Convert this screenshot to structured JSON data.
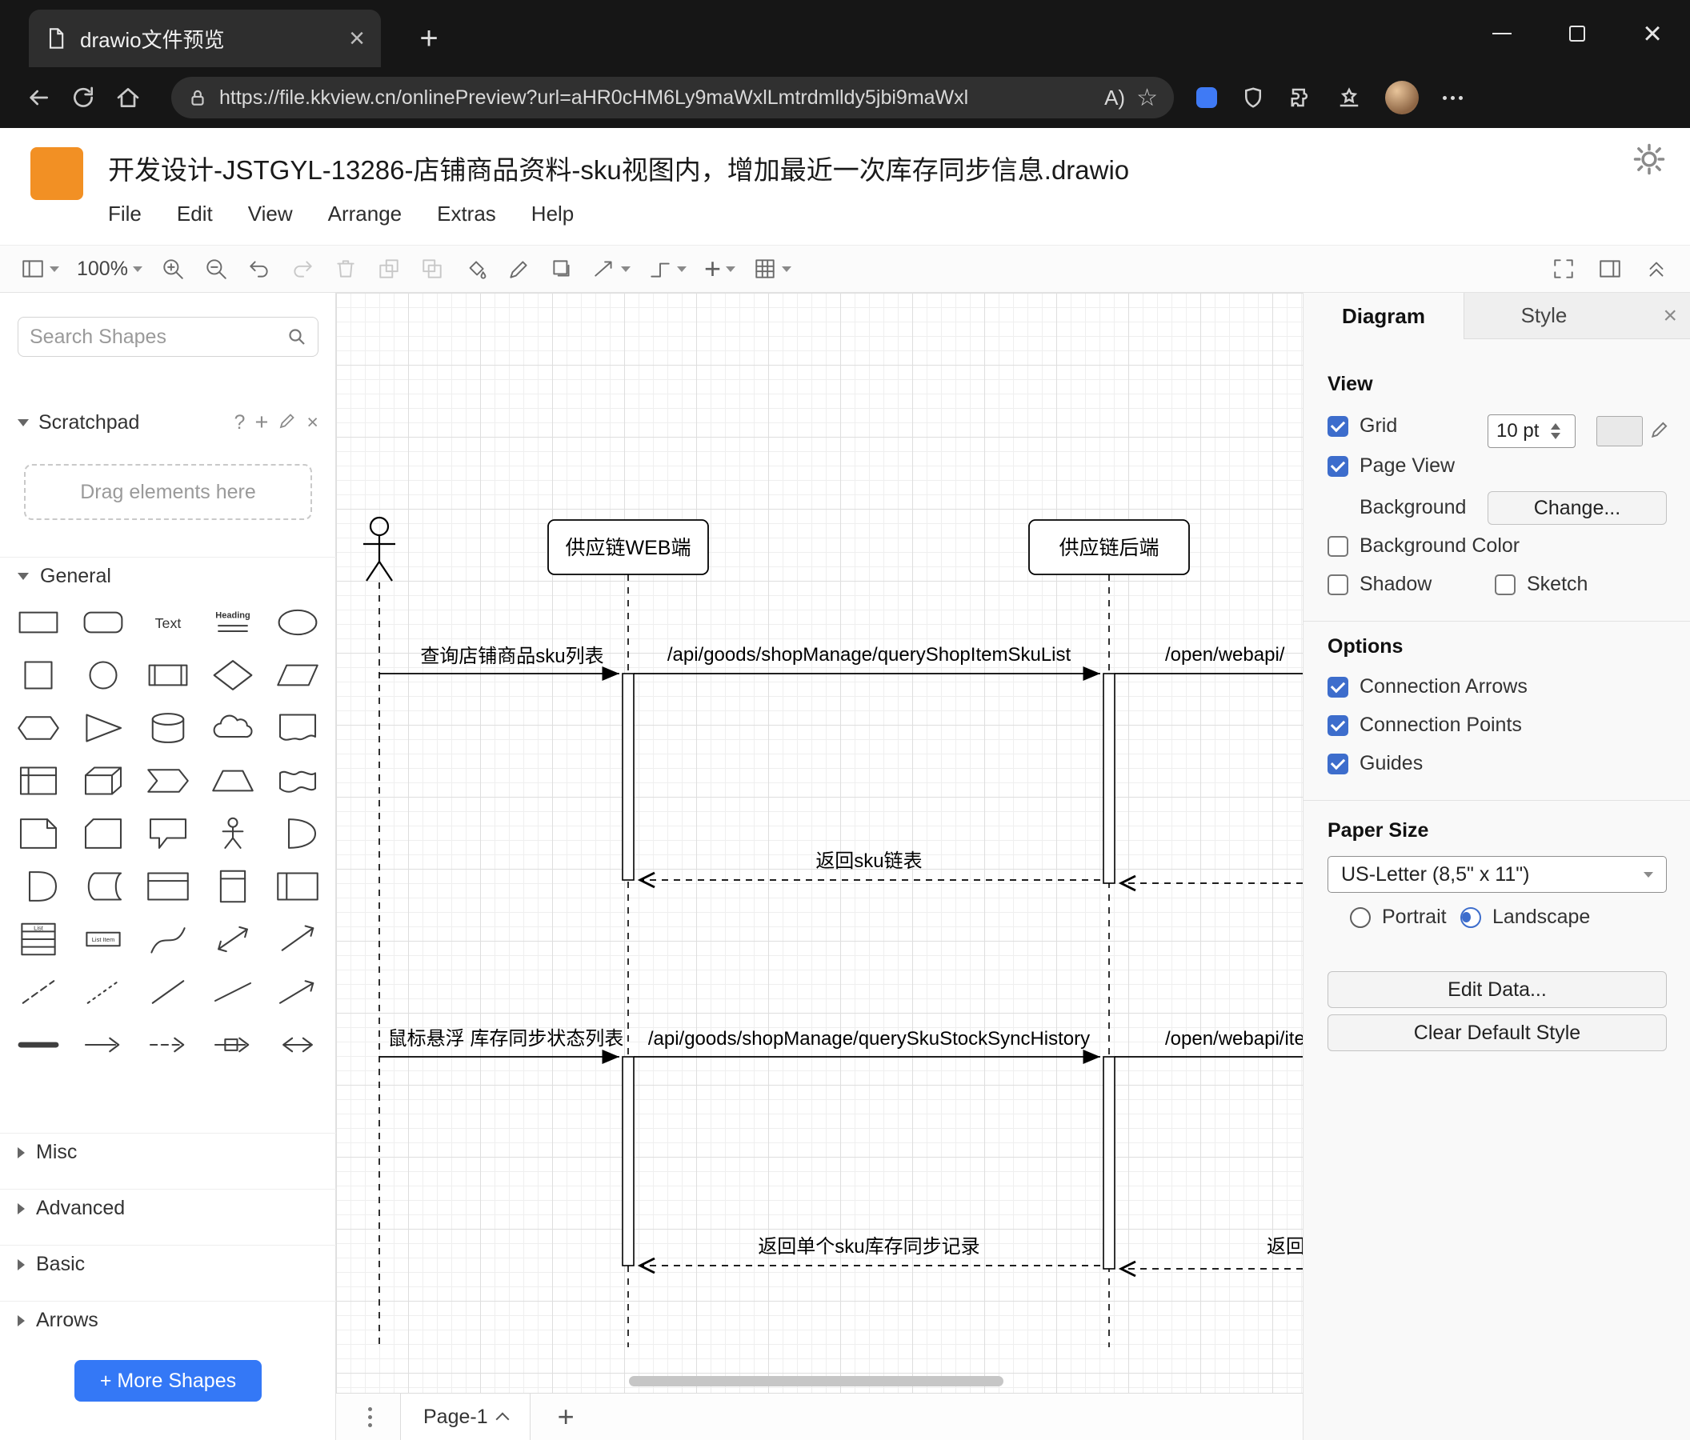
{
  "colors": {
    "accent_blue": "#3d6dcc",
    "drawio_orange": "#f29024",
    "more_shapes_blue": "#3478f6"
  },
  "browser": {
    "tab_title": "drawio文件预览",
    "url": "https://file.kkview.cn/onlinePreview?url=aHR0cHM6Ly9maWxlLmtrdmlldy5jbi9maWxl"
  },
  "header": {
    "title": "开发设计-JSTGYL-13286-店铺商品资料-sku视图内，增加最近一次库存同步信息.drawio",
    "menus": [
      "File",
      "Edit",
      "View",
      "Arrange",
      "Extras",
      "Help"
    ]
  },
  "toolbar": {
    "zoom": "100%"
  },
  "sidebar": {
    "search_placeholder": "Search Shapes",
    "scratchpad_label": "Scratchpad",
    "drag_hint": "Drag elements here",
    "sections": {
      "general": "General",
      "misc": "Misc",
      "advanced": "Advanced",
      "basic": "Basic",
      "arrows": "Arrows"
    },
    "more_shapes_label": "+ More Shapes",
    "palette_text": {
      "text": "Text",
      "heading": "Heading",
      "list": "List",
      "list_item": "List Item"
    },
    "shapes": [
      "rectangle",
      "rounded-rectangle",
      "text",
      "heading",
      "ellipse",
      "square",
      "circle",
      "process",
      "diamond",
      "parallelogram",
      "hexagon",
      "triangle",
      "cylinder",
      "cloud",
      "document",
      "internal-storage",
      "cube",
      "step",
      "trapezoid",
      "tape",
      "note",
      "card",
      "callout",
      "actor",
      "or",
      "and",
      "data-storage",
      "container",
      "vertical-container",
      "horizontal-pool",
      "list",
      "list-item",
      "curve",
      "bidirectional-arrow",
      "directional-arrow",
      "dashed-line",
      "dotted-line",
      "line",
      "diagonal-line",
      "diagonal-arrow",
      "link",
      "arrow",
      "dashed-arrow",
      "labeled-arrow",
      "bidirectional-horizontal-arrow"
    ]
  },
  "canvas": {
    "page_tab": "Page-1",
    "diagram": {
      "lifeline_web": "供应链WEB端",
      "lifeline_backend": "供应链后端",
      "msg1": "查询店铺商品sku列表",
      "api1": "/api/goods/shopManage/queryShopItemSkuList",
      "ext1": "/open/webapi/",
      "ret1": "返回sku链表",
      "msg2": "鼠标悬浮 库存同步状态列表",
      "api2": "/api/goods/shopManage/querySkuStockSyncHistory",
      "ext2": "/open/webapi/item",
      "ret2": "返回单个sku库存同步记录",
      "ret2_right": "返回"
    }
  },
  "panel": {
    "tabs": [
      "Diagram",
      "Style"
    ],
    "view": {
      "title": "View",
      "grid": "Grid",
      "grid_size": "10 pt",
      "page_view": "Page View",
      "background": "Background",
      "change": "Change...",
      "background_color": "Background Color",
      "shadow": "Shadow",
      "sketch": "Sketch"
    },
    "options": {
      "title": "Options",
      "items": [
        "Connection Arrows",
        "Connection Points",
        "Guides"
      ]
    },
    "paper": {
      "title": "Paper Size",
      "size": "US-Letter (8,5\" x 11\")",
      "portrait": "Portrait",
      "landscape": "Landscape"
    },
    "buttons": {
      "edit_data": "Edit Data...",
      "clear_style": "Clear Default Style"
    }
  }
}
